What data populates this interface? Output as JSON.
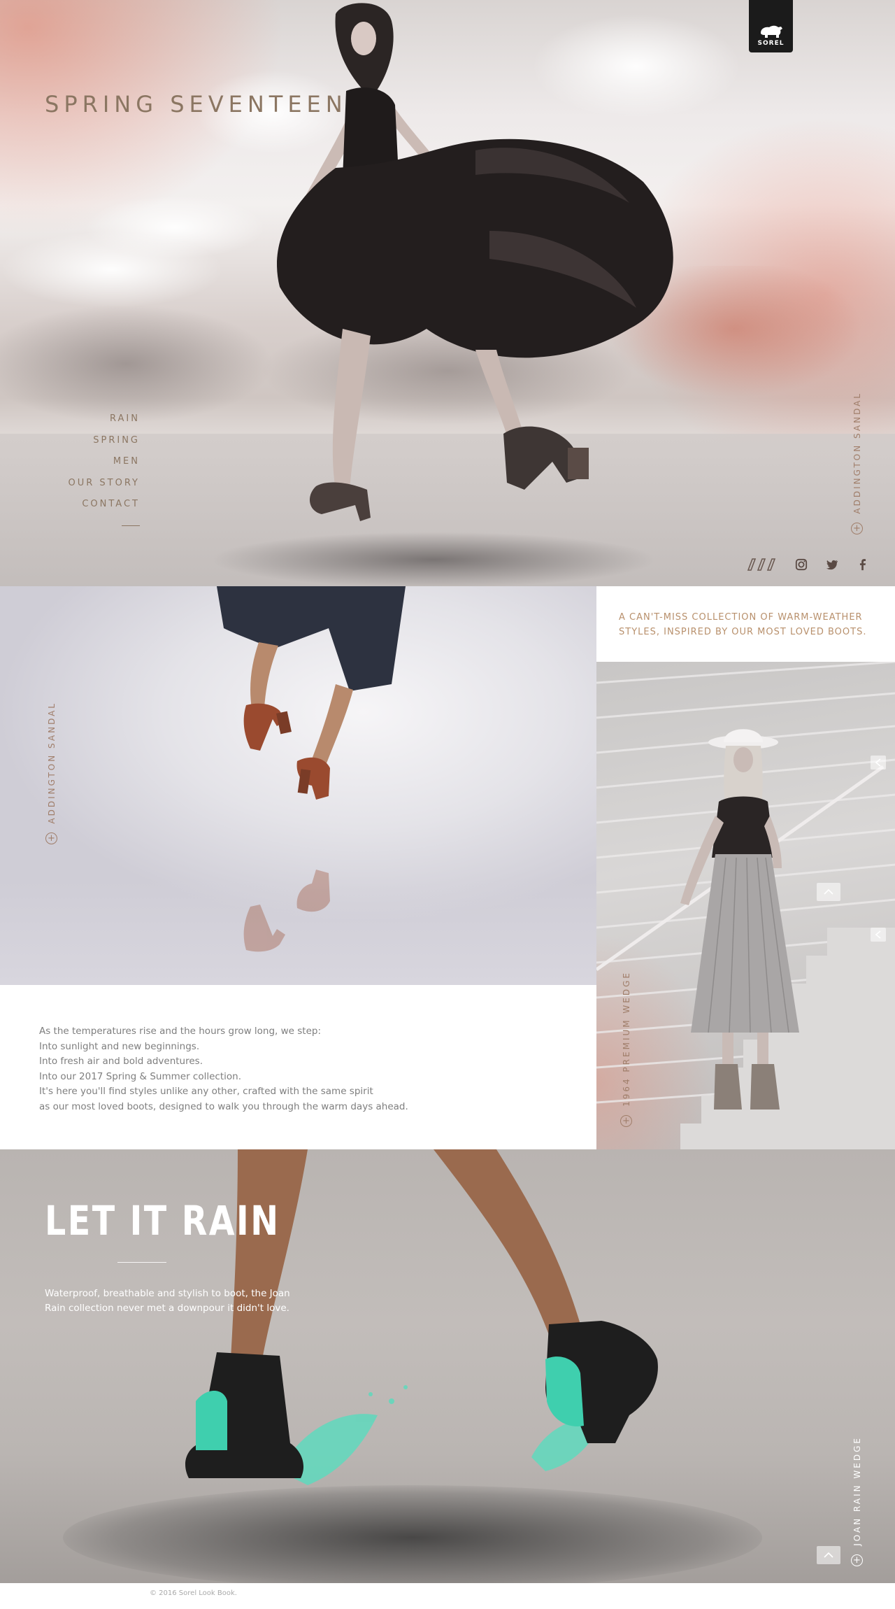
{
  "brand": {
    "logo_text": "SOREL"
  },
  "hero": {
    "title": "SPRING SEVENTEEN",
    "nav": [
      {
        "label": "RAIN"
      },
      {
        "label": "SPRING"
      },
      {
        "label": "MEN"
      },
      {
        "label": "OUR STORY"
      },
      {
        "label": "CONTACT"
      }
    ],
    "product_tag": "ADDINGTON SANDAL",
    "social_icons": [
      "brand-slashes-icon",
      "instagram-icon",
      "twitter-icon",
      "facebook-icon"
    ]
  },
  "lookbook": {
    "left_tag": "ADDINGTON SANDAL",
    "tagline": "A CAN'T-MISS COLLECTION OF WARM-WEATHER STYLES, INSPIRED BY OUR MOST LOVED BOOTS.",
    "right_tag": "1964 PREMIUM WEDGE",
    "copy": [
      "As the temperatures rise and the hours grow long, we step:",
      "Into sunlight and new beginnings.",
      "Into fresh air and bold adventures.",
      "Into our 2017 Spring & Summer collection.",
      "It's here you'll find styles unlike any other, crafted with the same spirit",
      "as our most loved boots, designed to walk you through the warm days ahead."
    ]
  },
  "rain": {
    "title": "LET IT RAIN",
    "copy": [
      "Waterproof, breathable and stylish to boot, the Joan",
      "Rain collection never met a downpour it didn't love."
    ],
    "product_tag": "JOAN RAIN WEDGE"
  },
  "footer": {
    "copyright": "© 2016 Sorel Look Book."
  },
  "colors": {
    "accent_brown": "#8b7662",
    "accent_tan": "#b8906c",
    "splash_teal": "#5fd9bd",
    "logo_bg": "#1b1b1b"
  }
}
